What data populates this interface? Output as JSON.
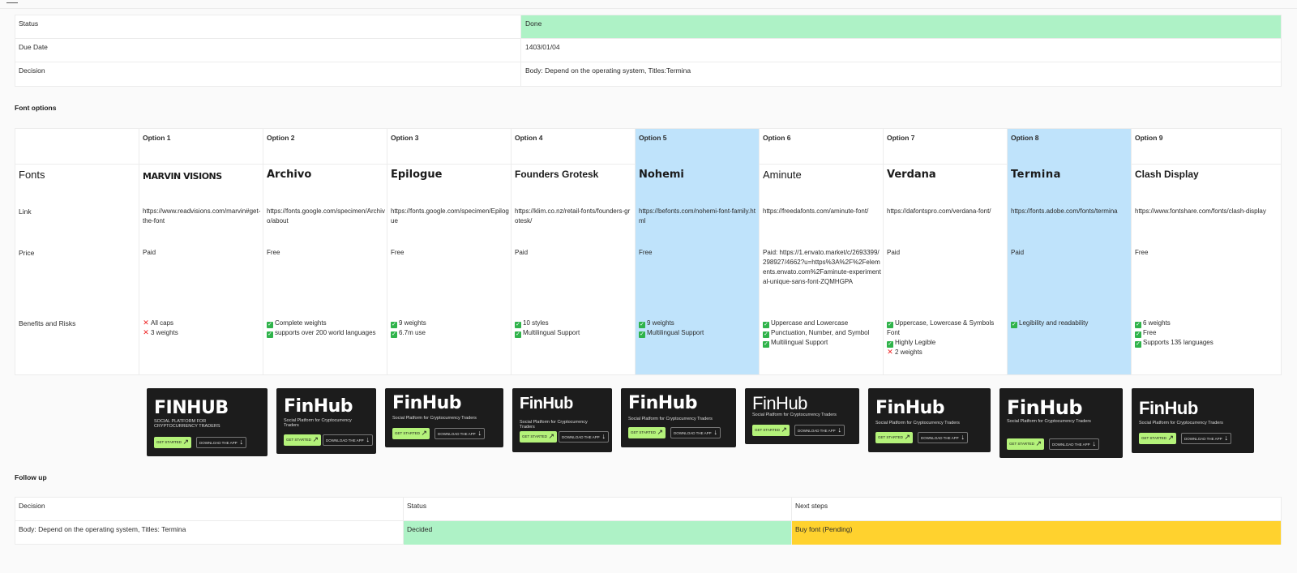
{
  "summary": {
    "rows": [
      {
        "label": "Status",
        "value": "Done"
      },
      {
        "label": "Due Date",
        "value": "1403/01/04"
      },
      {
        "label": "Decision",
        "value": "Body: Depend on the operating system, Titles:Termina"
      }
    ],
    "status_color": "#aef2c6"
  },
  "font_options": {
    "title": "Font options",
    "row_labels": {
      "fonts": "Fonts",
      "link": "Link",
      "price": "Price",
      "benefits": "Benefits and Risks"
    },
    "options": [
      {
        "header": "Option 1",
        "font": "MARVIN VISIONS",
        "link": "https://www.readvisions.com/marvin#get-the-font",
        "price": "Paid",
        "benefits": [
          {
            "ok": false,
            "text": "All caps"
          },
          {
            "ok": false,
            "text": "3 weights"
          }
        ]
      },
      {
        "header": "Option 2",
        "font": "Archivo",
        "link": "https://fonts.google.com/specimen/Archivo/about",
        "price": "Free",
        "benefits": [
          {
            "ok": true,
            "text": "Complete weights"
          },
          {
            "ok": true,
            "text": "supports over 200 world languages"
          }
        ]
      },
      {
        "header": "Option 3",
        "font": "Epilogue",
        "link": "https://fonts.google.com/specimen/Epilogue",
        "price": "Free",
        "benefits": [
          {
            "ok": true,
            "text": "9 weights"
          },
          {
            "ok": true,
            "text": "6.7m use"
          }
        ]
      },
      {
        "header": "Option 4",
        "font": "Founders Grotesk",
        "link": "https://klim.co.nz/retail-fonts/founders-grotesk/",
        "price": "Paid",
        "benefits": [
          {
            "ok": true,
            "text": "10 styles"
          },
          {
            "ok": true,
            "text": "Multilingual Support"
          }
        ]
      },
      {
        "header": "Option 5",
        "font": "Nohemi",
        "link": "https://befonts.com/nohemi-font-family.html",
        "price": "Free",
        "highlight": true,
        "benefits": [
          {
            "ok": true,
            "text": "9 weights"
          },
          {
            "ok": true,
            "text": "Multilingual Support"
          }
        ]
      },
      {
        "header": "Option 6",
        "font": "Aminute",
        "link": "https://freedafonts.com/aminute-font/",
        "price": "Paid: https://1.envato.market/c/2693399/298927/4662?u=https%3A%2F%2Felements.envato.com%2Faminute-experimental-unique-sans-font-ZQMHGPA",
        "benefits": [
          {
            "ok": true,
            "text": "Uppercase and Lowercase"
          },
          {
            "ok": true,
            "text": "Punctuation, Number, and Symbol"
          },
          {
            "ok": true,
            "text": "Multilingual Support"
          }
        ]
      },
      {
        "header": "Option 7",
        "font": "Verdana",
        "link": "https://dafontspro.com/verdana-font/",
        "price": "Paid",
        "benefits": [
          {
            "ok": true,
            "text": "Uppercase, Lowercase & Symbols Font"
          },
          {
            "ok": true,
            "text": "Highly Legible"
          },
          {
            "ok": false,
            "text": "2 weights"
          }
        ]
      },
      {
        "header": "Option 8",
        "font": "Termina",
        "link": "https://fonts.adobe.com/fonts/termina",
        "price": "Paid",
        "highlight": true,
        "benefits": [
          {
            "ok": true,
            "text": "Legibility and readability"
          }
        ]
      },
      {
        "header": "Option 9",
        "font": "Clash Display",
        "link": "https://www.fontshare.com/fonts/clash-display",
        "price": "Free",
        "benefits": [
          {
            "ok": true,
            "text": "6 weights"
          },
          {
            "ok": true,
            "text": "Free"
          },
          {
            "ok": true,
            "text": "Supports 135 languages"
          }
        ]
      }
    ],
    "highlight_color": "#bfe3fb"
  },
  "previews": [
    {
      "logo": "FINHUB",
      "subtitle": "SOCIAL PLATFORM FOR CRYPTOCURRENCY TRADERS",
      "cta": "GET STARTED",
      "secondary": "DOWNLOAD THE APP"
    },
    {
      "logo": "FinHub",
      "subtitle": "Social Platform for Cryptocurrency Traders",
      "cta": "GET STARTED",
      "secondary": "DOWNLOAD THE APP"
    },
    {
      "logo": "FinHub",
      "subtitle": "Social Platform for Cryptocurrency Traders",
      "cta": "GET STARTED",
      "secondary": "DOWNLOAD THE APP"
    },
    {
      "logo": "FinHub",
      "subtitle": "Social Platform for Cryptocurrency Traders",
      "cta": "GET STARTED",
      "secondary": "DOWNLOAD THE APP"
    },
    {
      "logo": "FinHub",
      "subtitle": "Social Platform for Cryptocurrency Traders",
      "cta": "GET STARTED",
      "secondary": "DOWNLOAD THE APP"
    },
    {
      "logo": "FinHub",
      "subtitle": "Social Platform for Cryptocurrency Traders",
      "cta": "GET STARTED",
      "secondary": "DOWNLOAD THE APP"
    },
    {
      "logo": "FinHub",
      "subtitle": "Social Platform for Cryptocurrency Traders",
      "cta": "GET STARTED",
      "secondary": "DOWNLOAD THE APP"
    },
    {
      "logo": "FinHub",
      "subtitle": "Social Platform for Cryptocurrency Traders",
      "cta": "GET STARTED",
      "secondary": "DOWNLOAD THE APP"
    },
    {
      "logo": "FinHub",
      "subtitle": "Social Platform for Cryptocurrency Traders",
      "cta": "GET STARTED",
      "secondary": "DOWNLOAD THE APP"
    }
  ],
  "follow_up": {
    "title": "Follow up",
    "headers": [
      "Decision",
      "Status",
      "Next steps"
    ],
    "row": {
      "decision": "Body: Depend on the operating system, Titles: Termina",
      "status": "Decided",
      "next": "Buy font (Pending)"
    },
    "status_color": "#aef2c6",
    "next_color": "#ffd22e"
  }
}
